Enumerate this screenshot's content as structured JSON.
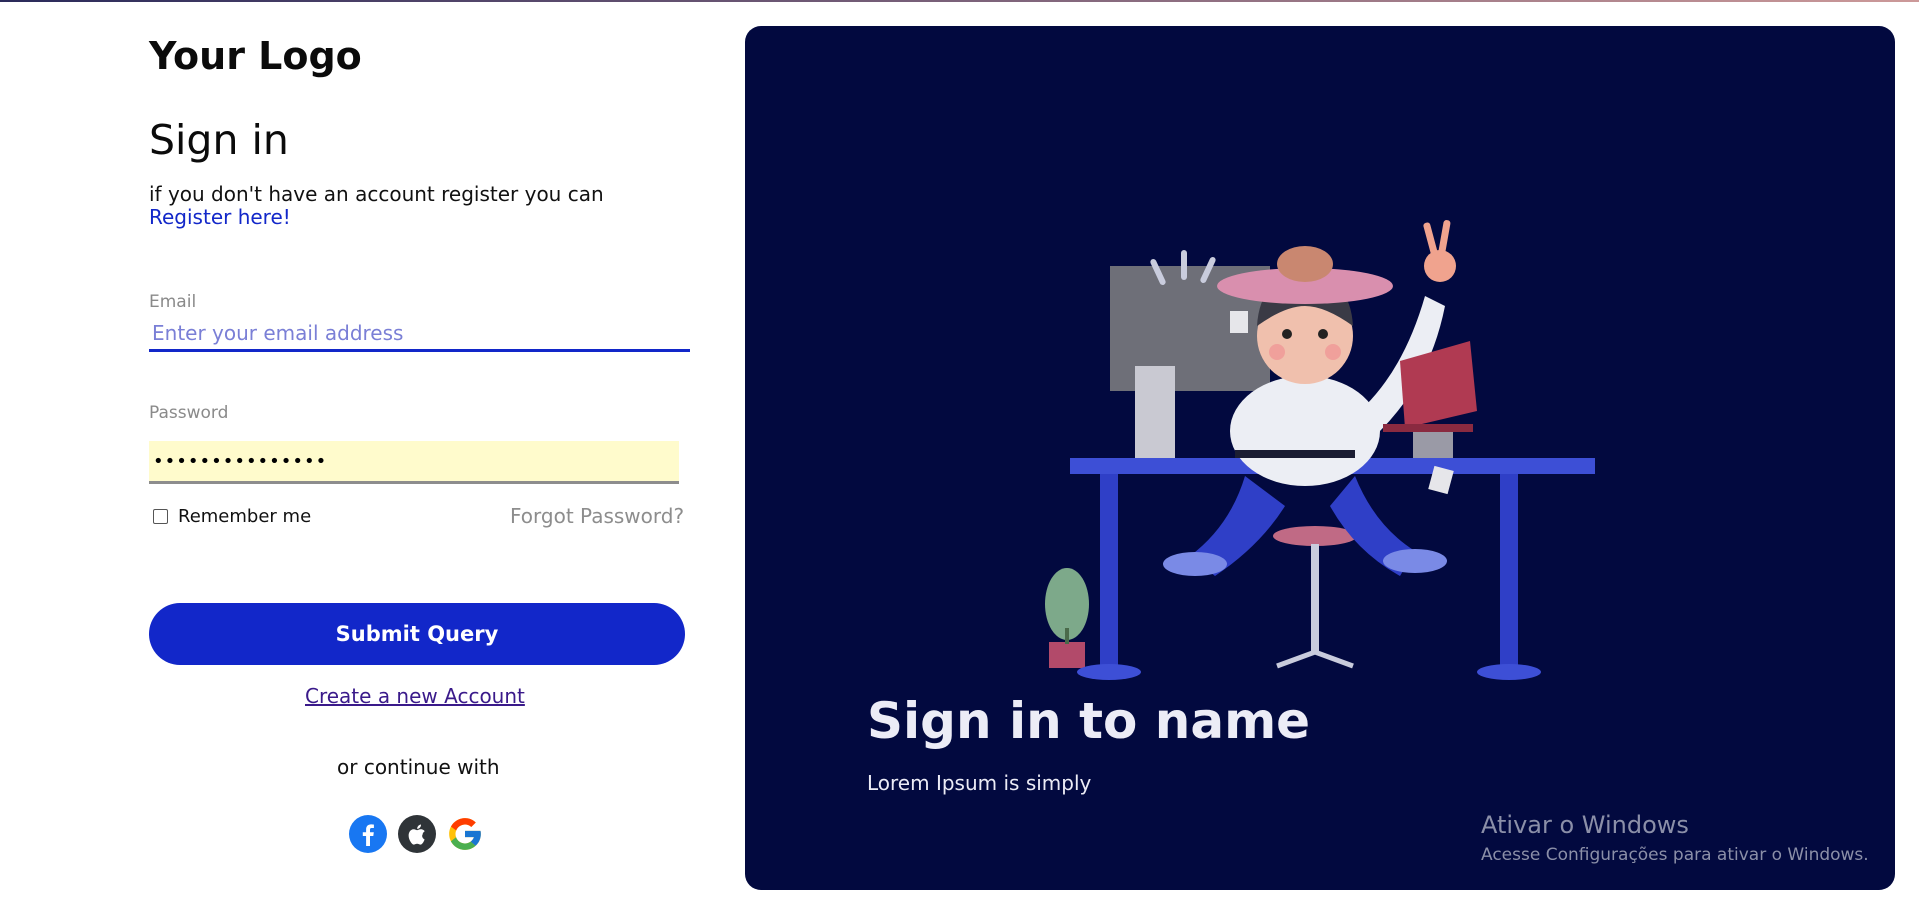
{
  "brand": {
    "logo": "Your Logo"
  },
  "form": {
    "title": "Sign in",
    "register_text": "if you don't have an account register you can",
    "register_link": "Register here!",
    "email": {
      "label": "Email",
      "placeholder": "Enter your email address"
    },
    "password": {
      "label": "Password",
      "value": "•••••••••••••••"
    },
    "remember_label": "Remember me",
    "forgot_label": "Forgot Password?",
    "submit_label": "Submit Query",
    "create_account": "Create a new Account",
    "or_continue": "or continue with",
    "social": [
      "facebook-icon",
      "apple-icon",
      "google-icon"
    ]
  },
  "panel": {
    "title": "Sign in to name",
    "subtitle": "Lorem Ipsum is simply",
    "background": "#02093f"
  },
  "watermark": {
    "title": "Ativar o Windows",
    "subtitle": "Acesse Configurações para ativar o Windows."
  },
  "colors": {
    "accent": "#1227c9",
    "autofill": "#fffbcc"
  }
}
